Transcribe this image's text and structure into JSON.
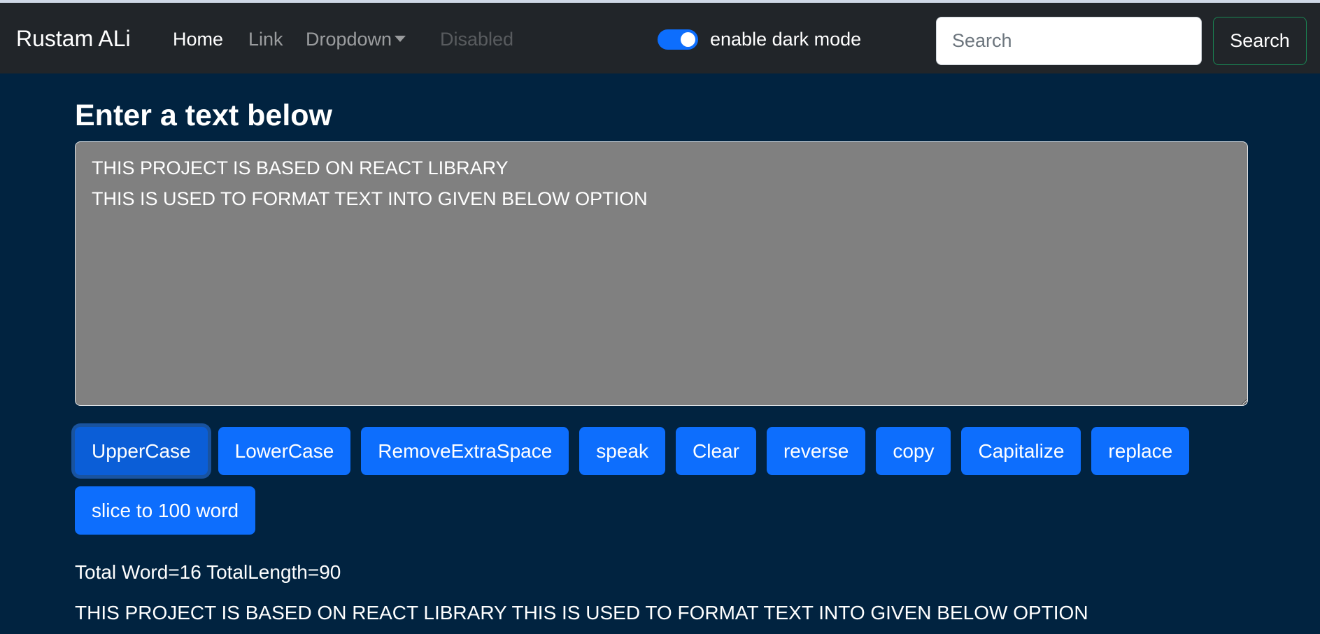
{
  "navbar": {
    "brand": "Rustam ALi",
    "links": {
      "home": "Home",
      "link": "Link",
      "dropdown": "Dropdown",
      "disabled": "Disabled"
    },
    "dark_mode_toggle": {
      "label": "enable dark mode",
      "checked": true
    },
    "search": {
      "placeholder": "Search",
      "value": "",
      "button_label": "Search"
    }
  },
  "main": {
    "heading": "Enter a text below",
    "textarea_value": "THIS PROJECT IS BASED ON REACT LIBRARY\nTHIS IS USED TO FORMAT TEXT INTO GIVEN BELOW OPTION",
    "buttons": [
      "UpperCase",
      "LowerCase",
      "RemoveExtraSpace",
      "speak",
      "Clear",
      "reverse",
      "copy",
      "Capitalize",
      "replace",
      "slice to 100 word"
    ],
    "summary": "Total Word=16 TotalLength=90",
    "preview": "THIS PROJECT IS BASED ON REACT LIBRARY THIS IS USED TO FORMAT TEXT INTO GIVEN BELOW OPTION"
  },
  "colors": {
    "navbar_bg": "#212529",
    "page_bg": "#012340",
    "accent": "#0d6efd",
    "textarea_bg": "#808080",
    "search_button_border": "#198754"
  }
}
